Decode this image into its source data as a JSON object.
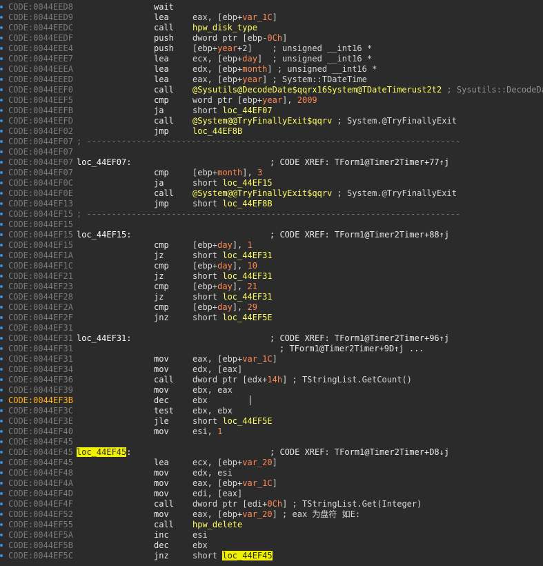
{
  "lines": [
    {
      "a": "CODE:0044EED8",
      "m": "wait"
    },
    {
      "a": "CODE:0044EED9",
      "m": "lea",
      "o": [
        [
          "eax, [ebp+",
          ""
        ],
        [
          "var_1C",
          "num"
        ],
        [
          "]",
          ""
        ]
      ]
    },
    {
      "a": "CODE:0044EEDC",
      "m": "call",
      "o": [
        [
          "hpw_disk_type",
          "fn"
        ]
      ]
    },
    {
      "a": "CODE:0044EEDF",
      "m": "push",
      "o": [
        [
          "dword ptr [ebp-",
          ""
        ],
        [
          "0Ch",
          "num"
        ],
        [
          "]",
          ""
        ]
      ]
    },
    {
      "a": "CODE:0044EEE4",
      "m": "push",
      "o": [
        [
          "[ebp+",
          ""
        ],
        [
          "year",
          "num"
        ],
        [
          "+2]    ; unsigned __int16 *",
          ""
        ]
      ]
    },
    {
      "a": "CODE:0044EEE7",
      "m": "lea",
      "o": [
        [
          "ecx, [ebp+",
          ""
        ],
        [
          "day",
          "num"
        ],
        [
          "]  ; unsigned __int16 *",
          ""
        ]
      ]
    },
    {
      "a": "CODE:0044EEEA",
      "m": "lea",
      "o": [
        [
          "edx, [ebp+",
          ""
        ],
        [
          "month",
          "num"
        ],
        [
          "] ; unsigned __int16 *",
          ""
        ]
      ]
    },
    {
      "a": "CODE:0044EEED",
      "m": "lea",
      "o": [
        [
          "eax, [ebp+",
          ""
        ],
        [
          "year",
          "num"
        ],
        [
          "] ; System::TDateTime",
          ""
        ]
      ]
    },
    {
      "a": "CODE:0044EEF0",
      "m": "call",
      "o": [
        [
          "@Sysutils@DecodeDate$qqrx16System@TDateTimerust2t2",
          "fn"
        ],
        [
          " ; Sysutils::DecodeDate",
          "gray"
        ]
      ]
    },
    {
      "a": "CODE:0044EEF5",
      "m": "cmp",
      "o": [
        [
          "word ptr [ebp+",
          ""
        ],
        [
          "year",
          "num"
        ],
        [
          "], ",
          ""
        ],
        [
          "2009",
          "num"
        ]
      ]
    },
    {
      "a": "CODE:0044EEFB",
      "m": "ja",
      "o": [
        [
          "short ",
          ""
        ],
        [
          "loc_44EF07",
          "fn"
        ]
      ]
    },
    {
      "a": "CODE:0044EEFD",
      "m": "call",
      "o": [
        [
          "@System@@TryFinallyExit$qqrv",
          "fn"
        ],
        [
          " ; System.@TryFinallyExit",
          ""
        ]
      ]
    },
    {
      "a": "CODE:0044EF02",
      "m": "jmp",
      "o": [
        [
          "loc_44EF8B",
          "fn"
        ]
      ]
    },
    {
      "a": "CODE:0044EF07",
      "sep": "; ---------------------------------------------------------------------------"
    },
    {
      "a": "CODE:0044EF07"
    },
    {
      "a": "CODE:0044EF07",
      "l": "loc_44EF07:",
      "c": "; CODE XREF: TForm1@Timer2Timer+77↑j"
    },
    {
      "a": "CODE:0044EF07",
      "m": "cmp",
      "o": [
        [
          "[ebp+",
          ""
        ],
        [
          "month",
          "num"
        ],
        [
          "], ",
          ""
        ],
        [
          "3",
          "num"
        ]
      ]
    },
    {
      "a": "CODE:0044EF0C",
      "m": "ja",
      "o": [
        [
          "short ",
          ""
        ],
        [
          "loc_44EF15",
          "fn"
        ]
      ]
    },
    {
      "a": "CODE:0044EF0E",
      "m": "call",
      "o": [
        [
          "@System@@TryFinallyExit$qqrv",
          "fn"
        ],
        [
          " ; System.@TryFinallyExit",
          ""
        ]
      ]
    },
    {
      "a": "CODE:0044EF13",
      "m": "jmp",
      "o": [
        [
          "short ",
          ""
        ],
        [
          "loc_44EF8B",
          "fn"
        ]
      ]
    },
    {
      "a": "CODE:0044EF15",
      "sep": "; ---------------------------------------------------------------------------"
    },
    {
      "a": "CODE:0044EF15"
    },
    {
      "a": "CODE:0044EF15",
      "l": "loc_44EF15:",
      "c": "; CODE XREF: TForm1@Timer2Timer+88↑j"
    },
    {
      "a": "CODE:0044EF15",
      "m": "cmp",
      "o": [
        [
          "[ebp+",
          ""
        ],
        [
          "day",
          "num"
        ],
        [
          "], ",
          ""
        ],
        [
          "1",
          "num"
        ]
      ]
    },
    {
      "a": "CODE:0044EF1A",
      "m": "jz",
      "o": [
        [
          "short ",
          ""
        ],
        [
          "loc_44EF31",
          "fn"
        ]
      ]
    },
    {
      "a": "CODE:0044EF1C",
      "m": "cmp",
      "o": [
        [
          "[ebp+",
          ""
        ],
        [
          "day",
          "num"
        ],
        [
          "], ",
          ""
        ],
        [
          "10",
          "num"
        ]
      ]
    },
    {
      "a": "CODE:0044EF21",
      "m": "jz",
      "o": [
        [
          "short ",
          ""
        ],
        [
          "loc_44EF31",
          "fn"
        ]
      ]
    },
    {
      "a": "CODE:0044EF23",
      "m": "cmp",
      "o": [
        [
          "[ebp+",
          ""
        ],
        [
          "day",
          "num"
        ],
        [
          "], ",
          ""
        ],
        [
          "21",
          "num"
        ]
      ]
    },
    {
      "a": "CODE:0044EF28",
      "m": "jz",
      "o": [
        [
          "short ",
          ""
        ],
        [
          "loc_44EF31",
          "fn"
        ]
      ]
    },
    {
      "a": "CODE:0044EF2A",
      "m": "cmp",
      "o": [
        [
          "[ebp+",
          ""
        ],
        [
          "day",
          "num"
        ],
        [
          "], ",
          ""
        ],
        [
          "29",
          "num"
        ]
      ]
    },
    {
      "a": "CODE:0044EF2F",
      "m": "jnz",
      "o": [
        [
          "short ",
          ""
        ],
        [
          "loc_44EF5E",
          "fn"
        ]
      ]
    },
    {
      "a": "CODE:0044EF31"
    },
    {
      "a": "CODE:0044EF31",
      "l": "loc_44EF31:",
      "c": "; CODE XREF: TForm1@Timer2Timer+96↑j"
    },
    {
      "a": "CODE:0044EF31",
      "c": "; TForm1@Timer2Timer+9D↑j ..."
    },
    {
      "a": "CODE:0044EF31",
      "m": "mov",
      "o": [
        [
          "eax, [ebp+",
          ""
        ],
        [
          "var_1C",
          "num"
        ],
        [
          "]",
          ""
        ]
      ]
    },
    {
      "a": "CODE:0044EF34",
      "m": "mov",
      "o": [
        [
          "edx, [eax]",
          ""
        ]
      ]
    },
    {
      "a": "CODE:0044EF36",
      "m": "call",
      "o": [
        [
          "dword ptr [edx+",
          ""
        ],
        [
          "14h",
          "num"
        ],
        [
          "] ; TStringList.GetCount()",
          ""
        ]
      ]
    },
    {
      "a": "CODE:0044EF39",
      "m": "mov",
      "o": [
        [
          "ebx, eax",
          ""
        ]
      ]
    },
    {
      "a": "CODE:0044EF3B",
      "ah": true,
      "m": "dec",
      "o": [
        [
          "ebx",
          ""
        ]
      ],
      "cur": true
    },
    {
      "a": "CODE:0044EF3C",
      "m": "test",
      "o": [
        [
          "ebx, ebx",
          ""
        ]
      ]
    },
    {
      "a": "CODE:0044EF3E",
      "m": "jle",
      "o": [
        [
          "short ",
          ""
        ],
        [
          "loc_44EF5E",
          "fn"
        ]
      ]
    },
    {
      "a": "CODE:0044EF40",
      "m": "mov",
      "o": [
        [
          "esi, ",
          ""
        ],
        [
          "1",
          "num"
        ]
      ]
    },
    {
      "a": "CODE:0044EF45"
    },
    {
      "a": "CODE:0044EF45",
      "l": "loc_44EF45",
      "lh": true,
      "ls": ":",
      "c": "; CODE XREF: TForm1@Timer2Timer+D8↓j"
    },
    {
      "a": "CODE:0044EF45",
      "m": "lea",
      "o": [
        [
          "ecx, [ebp+",
          ""
        ],
        [
          "var_20",
          "num"
        ],
        [
          "]",
          ""
        ]
      ]
    },
    {
      "a": "CODE:0044EF48",
      "m": "mov",
      "o": [
        [
          "edx, esi",
          ""
        ]
      ]
    },
    {
      "a": "CODE:0044EF4A",
      "m": "mov",
      "o": [
        [
          "eax, [ebp+",
          ""
        ],
        [
          "var_1C",
          "num"
        ],
        [
          "]",
          ""
        ]
      ]
    },
    {
      "a": "CODE:0044EF4D",
      "m": "mov",
      "o": [
        [
          "edi, [eax]",
          ""
        ]
      ]
    },
    {
      "a": "CODE:0044EF4F",
      "m": "call",
      "o": [
        [
          "dword ptr [edi+",
          ""
        ],
        [
          "0Ch",
          "num"
        ],
        [
          "] ; TStringList.Get(Integer)",
          ""
        ]
      ]
    },
    {
      "a": "CODE:0044EF52",
      "m": "mov",
      "o": [
        [
          "eax, [ebp+",
          ""
        ],
        [
          "var_20",
          "num"
        ],
        [
          "] ; eax 为盘符 如E:",
          ""
        ]
      ]
    },
    {
      "a": "CODE:0044EF55",
      "m": "call",
      "o": [
        [
          "hpw_delete",
          "fn"
        ]
      ]
    },
    {
      "a": "CODE:0044EF5A",
      "m": "inc",
      "o": [
        [
          "esi",
          ""
        ]
      ]
    },
    {
      "a": "CODE:0044EF5B",
      "m": "dec",
      "o": [
        [
          "ebx",
          ""
        ]
      ]
    },
    {
      "a": "CODE:0044EF5C",
      "m": "jnz",
      "o": [
        [
          "short ",
          ""
        ],
        [
          "loc_44EF45",
          "hlbox"
        ]
      ]
    }
  ]
}
